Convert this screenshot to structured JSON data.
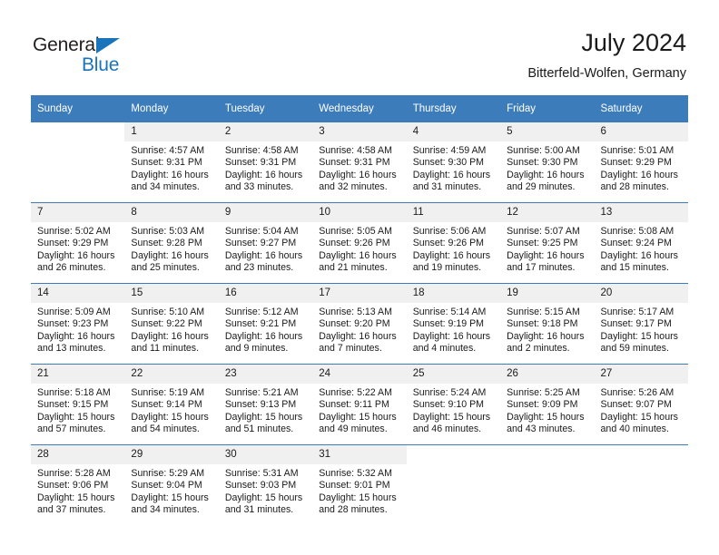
{
  "brand": {
    "name_part1": "General",
    "name_part2": "Blue",
    "color_primary": "#1a74bb",
    "color_text": "#231f20"
  },
  "header": {
    "title": "July 2024",
    "subtitle": "Bitterfeld-Wolfen, Germany"
  },
  "calendar": {
    "header_bg": "#3d7cbb",
    "daynum_bg": "#f0f0f0",
    "weekday_headers": [
      "Sunday",
      "Monday",
      "Tuesday",
      "Wednesday",
      "Thursday",
      "Friday",
      "Saturday"
    ],
    "weeks": [
      [
        {
          "day": "",
          "sunrise": "",
          "sunset": "",
          "daylight_line1": "",
          "daylight_line2": ""
        },
        {
          "day": "1",
          "sunrise": "Sunrise: 4:57 AM",
          "sunset": "Sunset: 9:31 PM",
          "daylight_line1": "Daylight: 16 hours",
          "daylight_line2": "and 34 minutes."
        },
        {
          "day": "2",
          "sunrise": "Sunrise: 4:58 AM",
          "sunset": "Sunset: 9:31 PM",
          "daylight_line1": "Daylight: 16 hours",
          "daylight_line2": "and 33 minutes."
        },
        {
          "day": "3",
          "sunrise": "Sunrise: 4:58 AM",
          "sunset": "Sunset: 9:31 PM",
          "daylight_line1": "Daylight: 16 hours",
          "daylight_line2": "and 32 minutes."
        },
        {
          "day": "4",
          "sunrise": "Sunrise: 4:59 AM",
          "sunset": "Sunset: 9:30 PM",
          "daylight_line1": "Daylight: 16 hours",
          "daylight_line2": "and 31 minutes."
        },
        {
          "day": "5",
          "sunrise": "Sunrise: 5:00 AM",
          "sunset": "Sunset: 9:30 PM",
          "daylight_line1": "Daylight: 16 hours",
          "daylight_line2": "and 29 minutes."
        },
        {
          "day": "6",
          "sunrise": "Sunrise: 5:01 AM",
          "sunset": "Sunset: 9:29 PM",
          "daylight_line1": "Daylight: 16 hours",
          "daylight_line2": "and 28 minutes."
        }
      ],
      [
        {
          "day": "7",
          "sunrise": "Sunrise: 5:02 AM",
          "sunset": "Sunset: 9:29 PM",
          "daylight_line1": "Daylight: 16 hours",
          "daylight_line2": "and 26 minutes."
        },
        {
          "day": "8",
          "sunrise": "Sunrise: 5:03 AM",
          "sunset": "Sunset: 9:28 PM",
          "daylight_line1": "Daylight: 16 hours",
          "daylight_line2": "and 25 minutes."
        },
        {
          "day": "9",
          "sunrise": "Sunrise: 5:04 AM",
          "sunset": "Sunset: 9:27 PM",
          "daylight_line1": "Daylight: 16 hours",
          "daylight_line2": "and 23 minutes."
        },
        {
          "day": "10",
          "sunrise": "Sunrise: 5:05 AM",
          "sunset": "Sunset: 9:26 PM",
          "daylight_line1": "Daylight: 16 hours",
          "daylight_line2": "and 21 minutes."
        },
        {
          "day": "11",
          "sunrise": "Sunrise: 5:06 AM",
          "sunset": "Sunset: 9:26 PM",
          "daylight_line1": "Daylight: 16 hours",
          "daylight_line2": "and 19 minutes."
        },
        {
          "day": "12",
          "sunrise": "Sunrise: 5:07 AM",
          "sunset": "Sunset: 9:25 PM",
          "daylight_line1": "Daylight: 16 hours",
          "daylight_line2": "and 17 minutes."
        },
        {
          "day": "13",
          "sunrise": "Sunrise: 5:08 AM",
          "sunset": "Sunset: 9:24 PM",
          "daylight_line1": "Daylight: 16 hours",
          "daylight_line2": "and 15 minutes."
        }
      ],
      [
        {
          "day": "14",
          "sunrise": "Sunrise: 5:09 AM",
          "sunset": "Sunset: 9:23 PM",
          "daylight_line1": "Daylight: 16 hours",
          "daylight_line2": "and 13 minutes."
        },
        {
          "day": "15",
          "sunrise": "Sunrise: 5:10 AM",
          "sunset": "Sunset: 9:22 PM",
          "daylight_line1": "Daylight: 16 hours",
          "daylight_line2": "and 11 minutes."
        },
        {
          "day": "16",
          "sunrise": "Sunrise: 5:12 AM",
          "sunset": "Sunset: 9:21 PM",
          "daylight_line1": "Daylight: 16 hours",
          "daylight_line2": "and 9 minutes."
        },
        {
          "day": "17",
          "sunrise": "Sunrise: 5:13 AM",
          "sunset": "Sunset: 9:20 PM",
          "daylight_line1": "Daylight: 16 hours",
          "daylight_line2": "and 7 minutes."
        },
        {
          "day": "18",
          "sunrise": "Sunrise: 5:14 AM",
          "sunset": "Sunset: 9:19 PM",
          "daylight_line1": "Daylight: 16 hours",
          "daylight_line2": "and 4 minutes."
        },
        {
          "day": "19",
          "sunrise": "Sunrise: 5:15 AM",
          "sunset": "Sunset: 9:18 PM",
          "daylight_line1": "Daylight: 16 hours",
          "daylight_line2": "and 2 minutes."
        },
        {
          "day": "20",
          "sunrise": "Sunrise: 5:17 AM",
          "sunset": "Sunset: 9:17 PM",
          "daylight_line1": "Daylight: 15 hours",
          "daylight_line2": "and 59 minutes."
        }
      ],
      [
        {
          "day": "21",
          "sunrise": "Sunrise: 5:18 AM",
          "sunset": "Sunset: 9:15 PM",
          "daylight_line1": "Daylight: 15 hours",
          "daylight_line2": "and 57 minutes."
        },
        {
          "day": "22",
          "sunrise": "Sunrise: 5:19 AM",
          "sunset": "Sunset: 9:14 PM",
          "daylight_line1": "Daylight: 15 hours",
          "daylight_line2": "and 54 minutes."
        },
        {
          "day": "23",
          "sunrise": "Sunrise: 5:21 AM",
          "sunset": "Sunset: 9:13 PM",
          "daylight_line1": "Daylight: 15 hours",
          "daylight_line2": "and 51 minutes."
        },
        {
          "day": "24",
          "sunrise": "Sunrise: 5:22 AM",
          "sunset": "Sunset: 9:11 PM",
          "daylight_line1": "Daylight: 15 hours",
          "daylight_line2": "and 49 minutes."
        },
        {
          "day": "25",
          "sunrise": "Sunrise: 5:24 AM",
          "sunset": "Sunset: 9:10 PM",
          "daylight_line1": "Daylight: 15 hours",
          "daylight_line2": "and 46 minutes."
        },
        {
          "day": "26",
          "sunrise": "Sunrise: 5:25 AM",
          "sunset": "Sunset: 9:09 PM",
          "daylight_line1": "Daylight: 15 hours",
          "daylight_line2": "and 43 minutes."
        },
        {
          "day": "27",
          "sunrise": "Sunrise: 5:26 AM",
          "sunset": "Sunset: 9:07 PM",
          "daylight_line1": "Daylight: 15 hours",
          "daylight_line2": "and 40 minutes."
        }
      ],
      [
        {
          "day": "28",
          "sunrise": "Sunrise: 5:28 AM",
          "sunset": "Sunset: 9:06 PM",
          "daylight_line1": "Daylight: 15 hours",
          "daylight_line2": "and 37 minutes."
        },
        {
          "day": "29",
          "sunrise": "Sunrise: 5:29 AM",
          "sunset": "Sunset: 9:04 PM",
          "daylight_line1": "Daylight: 15 hours",
          "daylight_line2": "and 34 minutes."
        },
        {
          "day": "30",
          "sunrise": "Sunrise: 5:31 AM",
          "sunset": "Sunset: 9:03 PM",
          "daylight_line1": "Daylight: 15 hours",
          "daylight_line2": "and 31 minutes."
        },
        {
          "day": "31",
          "sunrise": "Sunrise: 5:32 AM",
          "sunset": "Sunset: 9:01 PM",
          "daylight_line1": "Daylight: 15 hours",
          "daylight_line2": "and 28 minutes."
        },
        {
          "day": "",
          "sunrise": "",
          "sunset": "",
          "daylight_line1": "",
          "daylight_line2": ""
        },
        {
          "day": "",
          "sunrise": "",
          "sunset": "",
          "daylight_line1": "",
          "daylight_line2": ""
        },
        {
          "day": "",
          "sunrise": "",
          "sunset": "",
          "daylight_line1": "",
          "daylight_line2": ""
        }
      ]
    ]
  }
}
